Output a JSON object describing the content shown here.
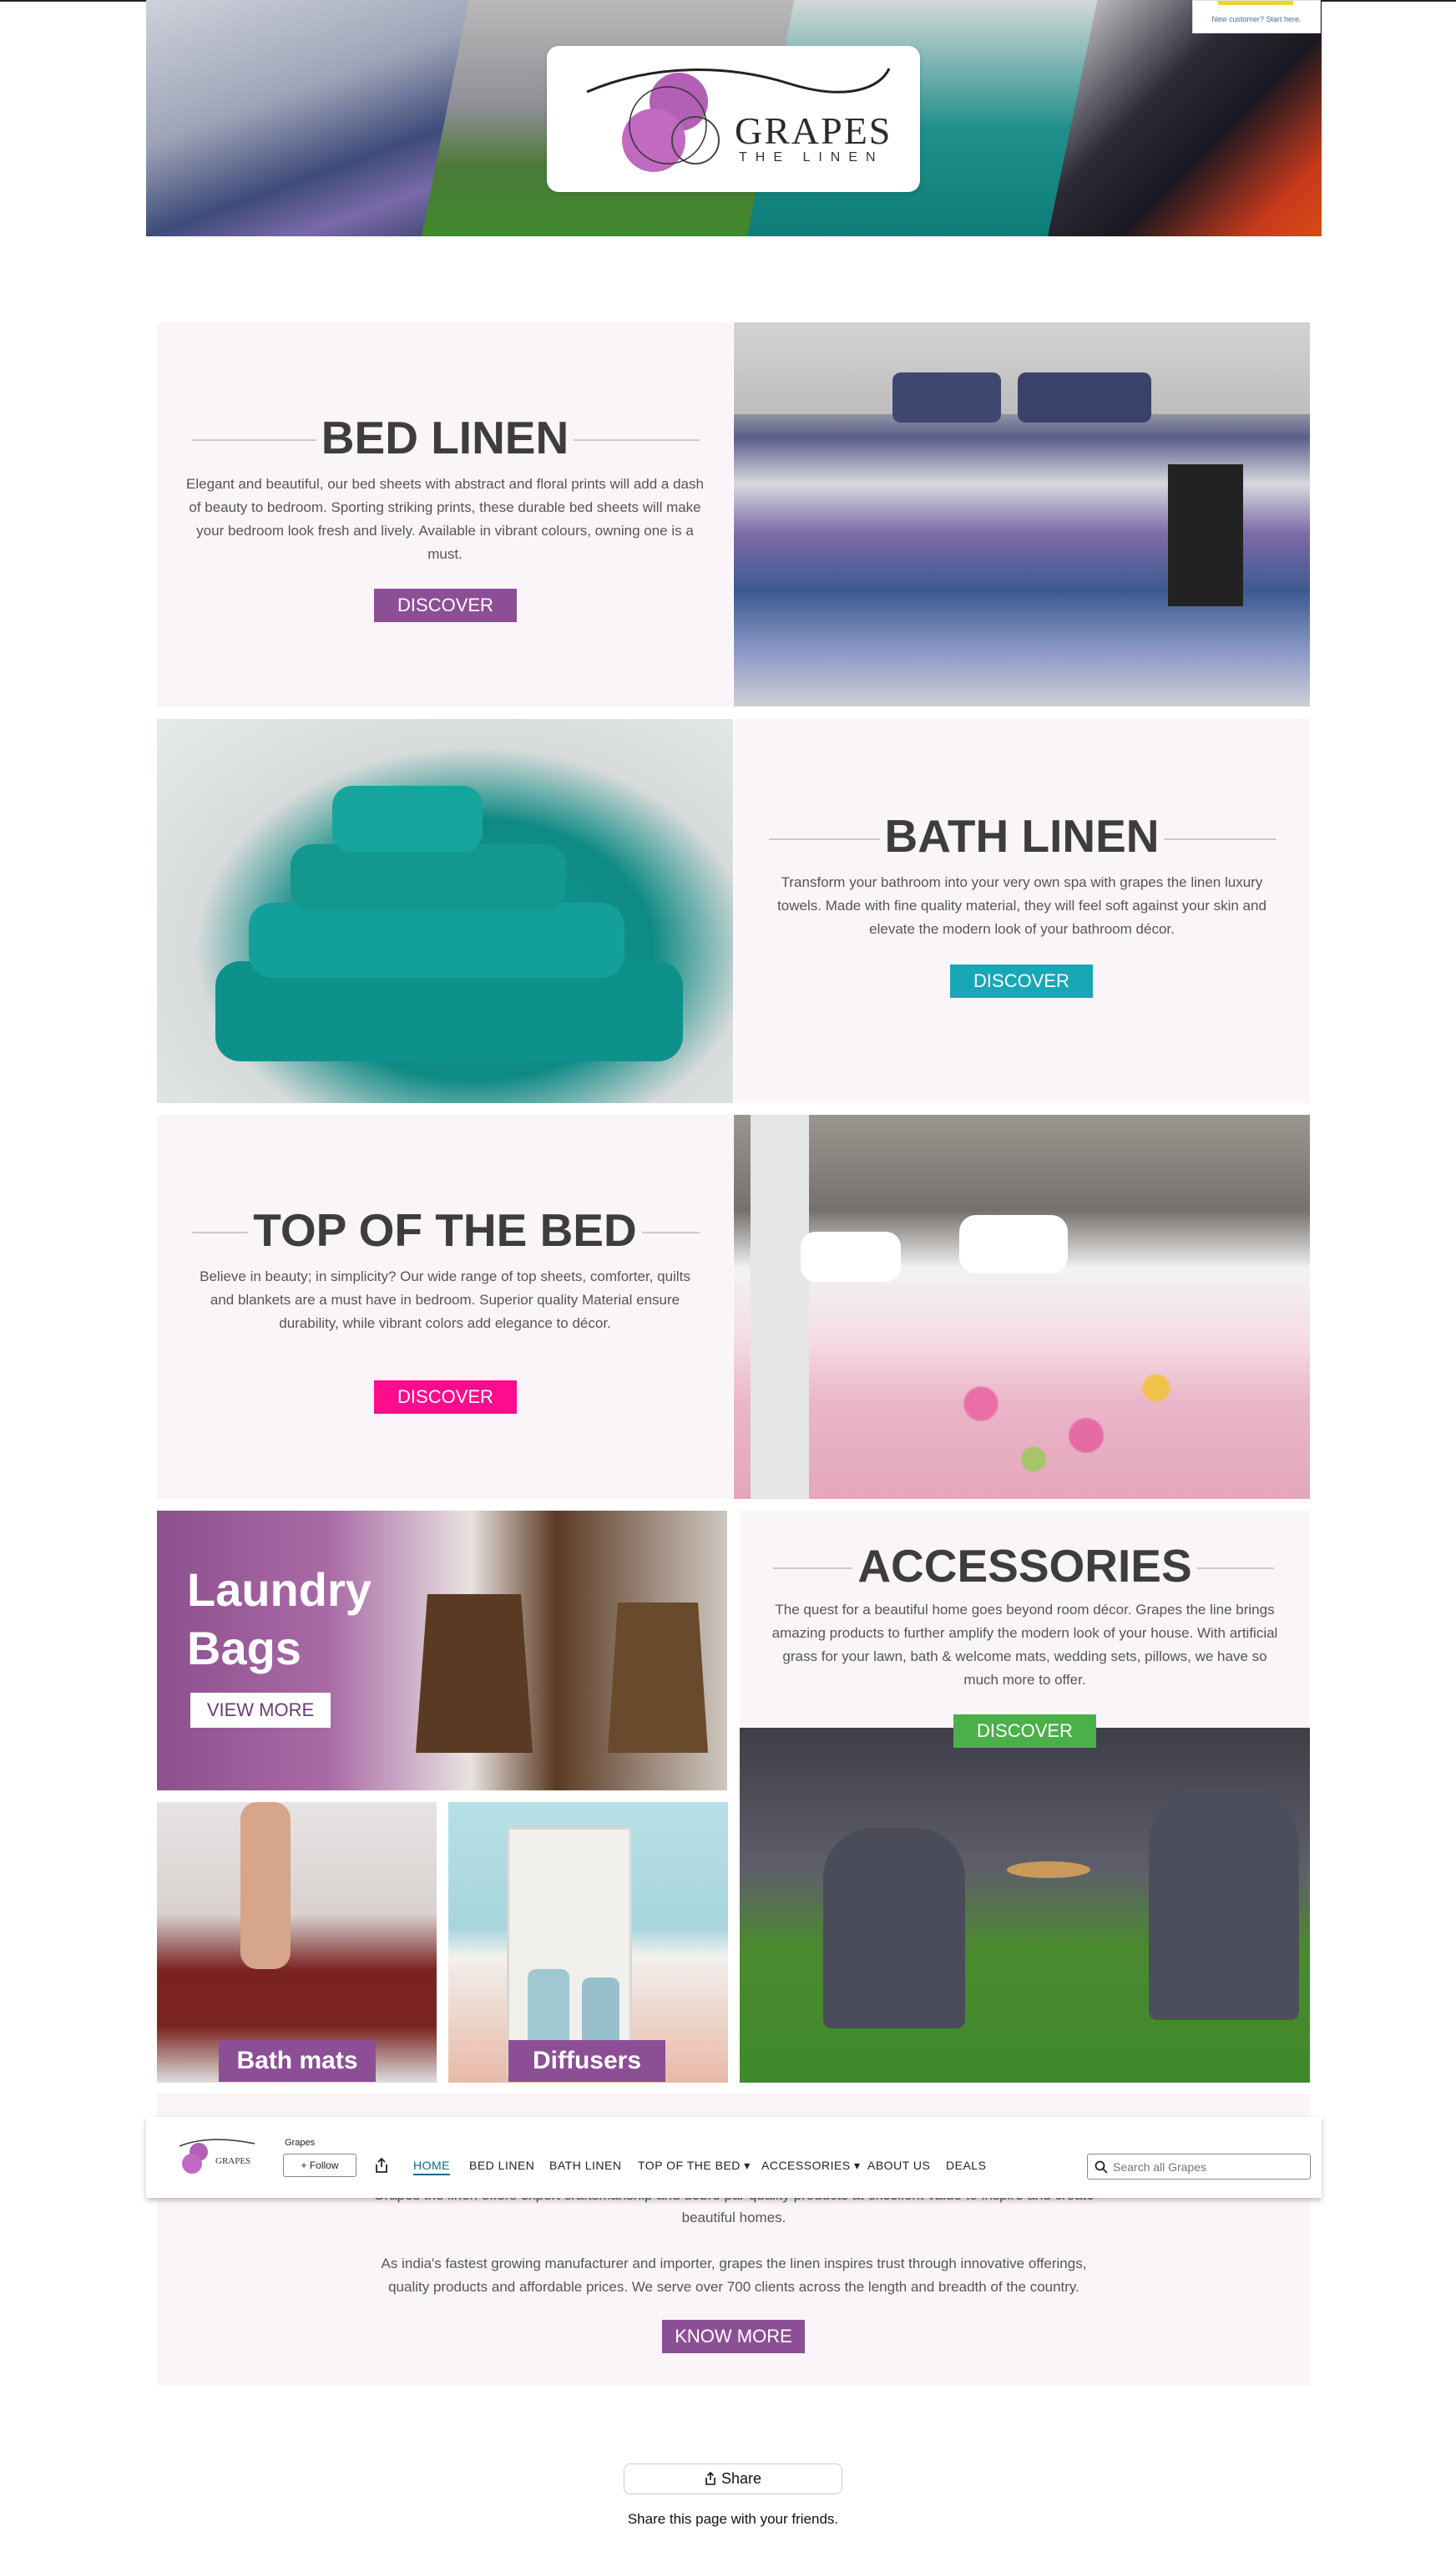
{
  "signin": {
    "text": "New customer? Start here."
  },
  "brand": {
    "name": "GRAPES",
    "tagline": "THE LINEN",
    "colors": {
      "purple": "#8c4f95",
      "teal": "#18a7b5",
      "pink": "#ff0b8d",
      "green": "#4cb04a"
    }
  },
  "sections": {
    "bed_linen": {
      "title": "BED LINEN",
      "description": "Elegant and beautiful, our bed sheets with abstract and floral prints will add a dash of beauty to bedroom. Sporting striking prints, these durable bed sheets will make your bedroom look fresh and lively. Available in vibrant colours, owning one is a must.",
      "button": "DISCOVER"
    },
    "bath_linen": {
      "title": "BATH LINEN",
      "description": "Transform your bathroom into your very own spa with grapes the linen luxury towels. Made with fine quality material, they will feel soft against your skin and elevate the modern look of your bathroom décor.",
      "button": "DISCOVER"
    },
    "top_of_bed": {
      "title": "TOP OF THE BED",
      "description": "Believe in beauty; in simplicity? Our wide range of top sheets, comforter, quilts and blankets are a must have in bedroom. Superior quality Material ensure durability, while vibrant colors add elegance to décor.",
      "button": "DISCOVER"
    },
    "accessories": {
      "title": "ACCESSORIES",
      "description": "The quest for a beautiful home goes beyond room décor. Grapes the line brings amazing products to further amplify the modern look of your house. With artificial grass for your lawn, bath & welcome mats, wedding sets, pillows, we have so much more to offer.",
      "button": "DISCOVER"
    }
  },
  "tiles": {
    "laundry": {
      "title_line1": "Laundry",
      "title_line2": "Bags",
      "button": "VIEW MORE"
    },
    "bath_mats": {
      "label": "Bath mats"
    },
    "diffusers": {
      "label": "Diffusers"
    }
  },
  "about": {
    "partial_line": "Grapes the linen offers expert craftsmanship and dobre par quality products at excellent value to inspire and create",
    "line2": "beautiful homes.",
    "para2_line1": "As india's fastest growing manufacturer and importer, grapes the linen inspires trust through innovative offerings,",
    "para2_line2": "quality products and affordable prices. We serve over 700 clients across the length and breadth of the country.",
    "button": "KNOW MORE"
  },
  "stickybar": {
    "store_name": "Grapes",
    "follow": "+ Follow",
    "nav": [
      "HOME",
      "BED LINEN",
      "BATH LINEN",
      "TOP OF THE BED ▾",
      "ACCESSORIES ▾",
      "ABOUT US",
      "DEALS"
    ],
    "search_placeholder": "Search all Grapes"
  },
  "share": {
    "button": "Share",
    "note": "Share this page with your friends."
  },
  "icons": {
    "share": "share-icon",
    "search": "search-icon",
    "logo": "grapes-logo"
  }
}
